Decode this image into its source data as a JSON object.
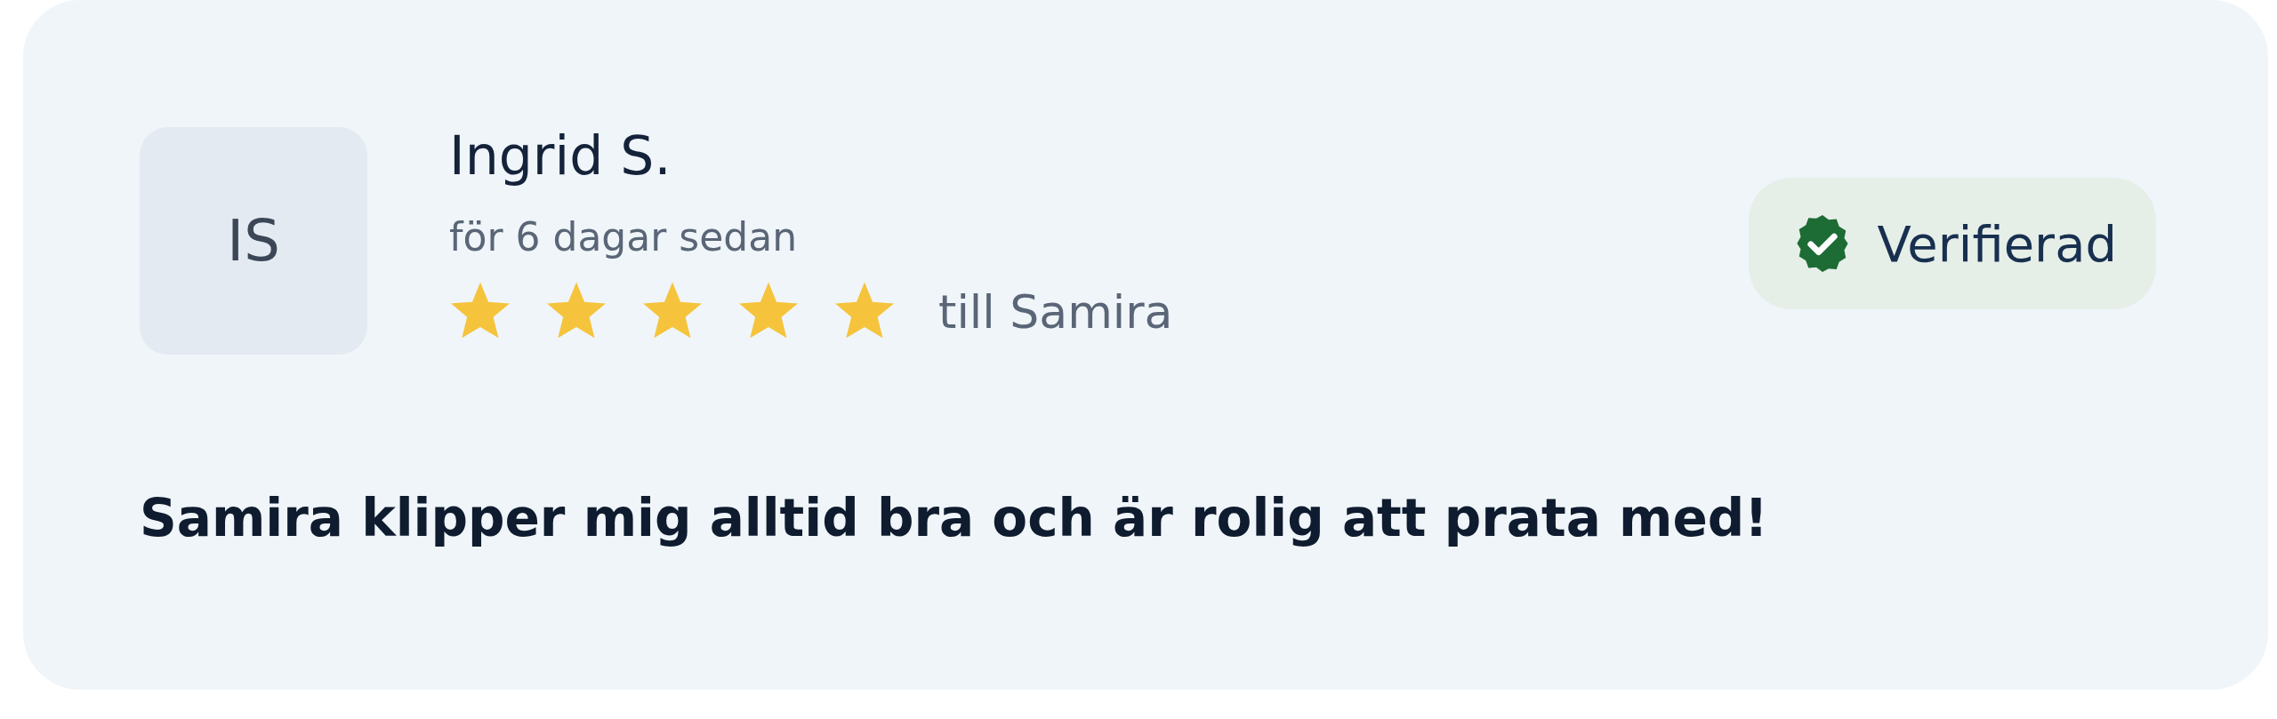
{
  "review": {
    "avatar_initials": "IS",
    "name": "Ingrid S.",
    "time": "för 6 dagar sedan",
    "stars": 5,
    "recipient": "till Samira",
    "badge": {
      "label": "Verifierad",
      "verified": true
    },
    "text": "Samira klipper mig alltid bra och är rolig att prata med!"
  }
}
